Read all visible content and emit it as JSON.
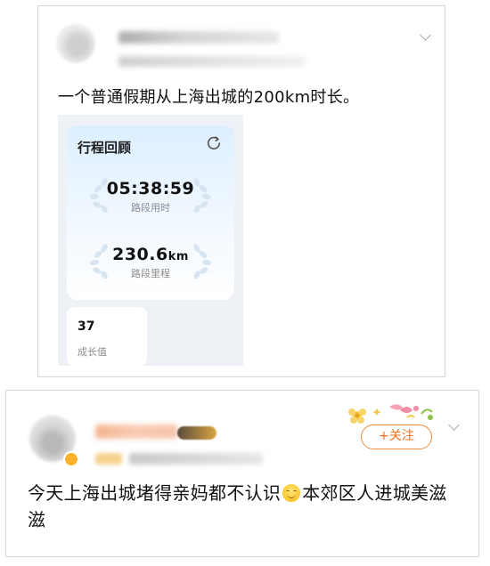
{
  "post": {
    "text": "一个普通假期从上海出城的200km时长。",
    "trip_card": {
      "title": "行程回顾",
      "duration_value": "05:38:59",
      "duration_label": "路段用时",
      "distance_value": "230.6",
      "distance_unit": "km",
      "distance_label": "路段里程",
      "growth_value": "37",
      "growth_label": "成长值"
    }
  },
  "comment": {
    "follow_label": "+关注",
    "text_part1": "今天上海出城堵得亲妈都不认识",
    "text_part2": "本郊区人进城美滋滋"
  },
  "colors": {
    "follow_accent": "#f06f1d",
    "trip_card_gradient_top": "#dcefff"
  },
  "icons": [
    "chevron-down-icon",
    "refresh-icon",
    "laurel-wreath-icon",
    "smile-emoji-icon",
    "flower-decoration-icon"
  ]
}
